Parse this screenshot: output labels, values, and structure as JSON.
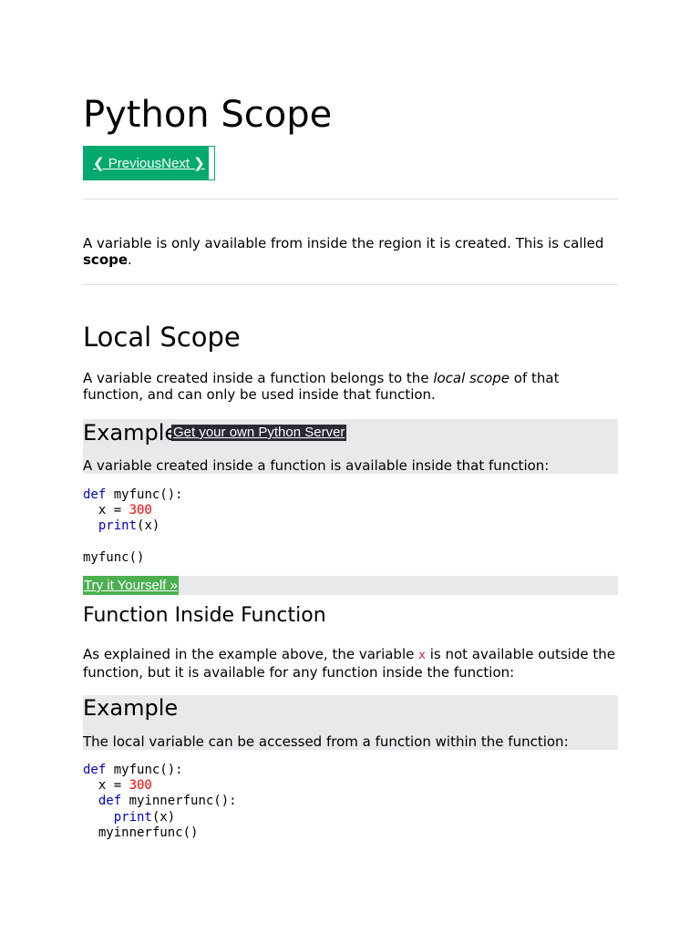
{
  "page": {
    "title": "Python Scope",
    "nav": {
      "previous": "❮ Previous",
      "next": "Next ❯"
    },
    "intro": {
      "text_before": "A variable is only available from inside the region it is created. This is called ",
      "bold": "scope",
      "text_after": "."
    }
  },
  "local_scope": {
    "heading": "Local Scope",
    "para_before": "A variable created inside a function belongs to the ",
    "para_italic": "local scope",
    "para_after": " of that function, and can only be used inside that function.",
    "example": {
      "heading": "Example",
      "server_link": "Get your own Python Server",
      "description": "A variable created inside a function is available inside that function:",
      "code": {
        "l1_kw": "def",
        "l1_rest": " myfunc():",
        "l2_pre": "  x = ",
        "l2_num": "300",
        "l3_pre": "  ",
        "l3_kw": "print",
        "l3_rest": "(x)",
        "l5": "myfunc()"
      },
      "try_button": "Try it Yourself »"
    }
  },
  "function_inside": {
    "heading": "Function Inside Function",
    "para_before": "As explained in the example above, the variable ",
    "para_var": "x",
    "para_after": " is not available outside the function, but it is available for any function inside the function:",
    "example": {
      "heading": "Example",
      "description": "The local variable can be accessed from a function within the function:",
      "code": {
        "l1_kw": "def",
        "l1_rest": " myfunc():",
        "l2_pre": "  x = ",
        "l2_num": "300",
        "l3_pre": "  ",
        "l3_kw": "def",
        "l3_rest": " myinnerfunc():",
        "l4_pre": "    ",
        "l4_kw": "print",
        "l4_rest": "(x)",
        "l5": "  myinnerfunc()"
      }
    }
  },
  "colors": {
    "nav_green": "#04aa6d",
    "try_green": "#4caf50",
    "example_bg": "#e7e9eb",
    "server_link_bg": "#282a35",
    "keyword_blue": "#0000cd",
    "number_red": "#ff0000",
    "variable_crimson": "#dc143c"
  }
}
